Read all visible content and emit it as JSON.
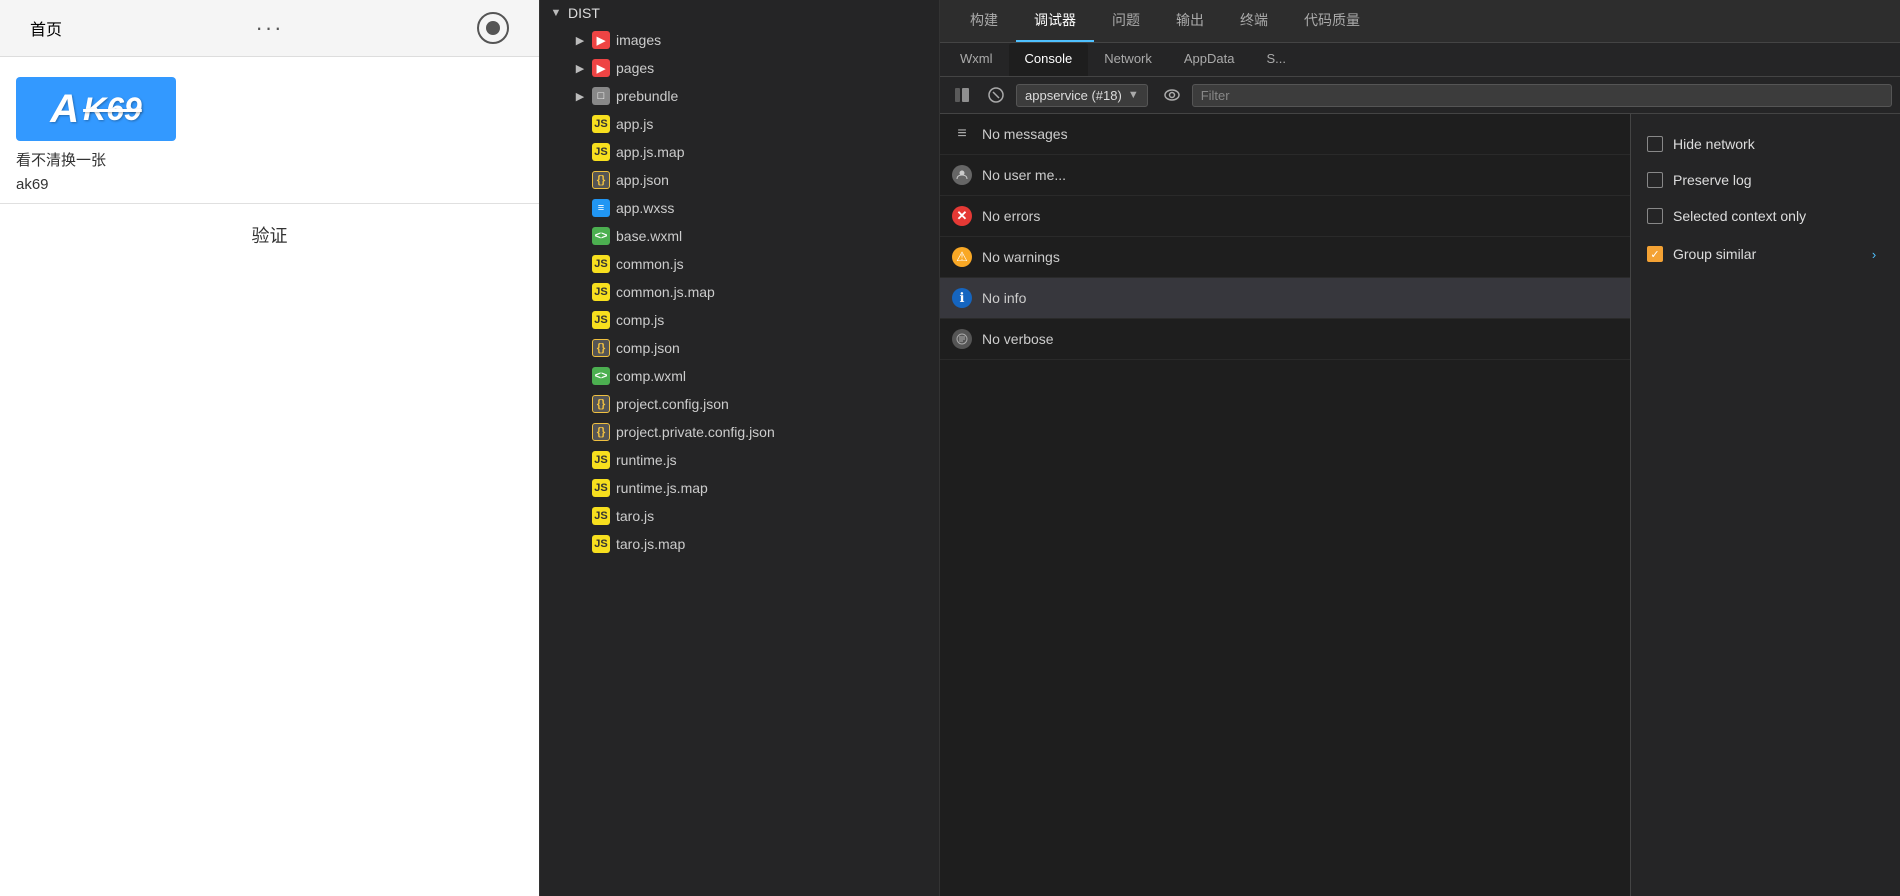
{
  "phone": {
    "title": "首页",
    "dots": "●●●",
    "captcha": {
      "letter": "A",
      "text": "K69",
      "refresh_link": "看不清换一张",
      "input_value": "ak69",
      "verify_btn": "验证"
    }
  },
  "file_tree": {
    "root": "DIST",
    "items": [
      {
        "name": "images",
        "type": "folder-red",
        "indent": 1,
        "arrow": true
      },
      {
        "name": "pages",
        "type": "folder-red",
        "indent": 1,
        "arrow": true
      },
      {
        "name": "prebundle",
        "type": "folder-blue",
        "indent": 1,
        "arrow": true
      },
      {
        "name": "app.js",
        "type": "js",
        "indent": 1
      },
      {
        "name": "app.js.map",
        "type": "js",
        "indent": 1
      },
      {
        "name": "app.json",
        "type": "json",
        "indent": 1
      },
      {
        "name": "app.wxss",
        "type": "wxss",
        "indent": 1
      },
      {
        "name": "base.wxml",
        "type": "wxml",
        "indent": 1
      },
      {
        "name": "common.js",
        "type": "js",
        "indent": 1
      },
      {
        "name": "common.js.map",
        "type": "js",
        "indent": 1
      },
      {
        "name": "comp.js",
        "type": "js",
        "indent": 1
      },
      {
        "name": "comp.json",
        "type": "json",
        "indent": 1
      },
      {
        "name": "comp.wxml",
        "type": "wxml",
        "indent": 1
      },
      {
        "name": "project.config.json",
        "type": "json",
        "indent": 1
      },
      {
        "name": "project.private.config.json",
        "type": "json",
        "indent": 1
      },
      {
        "name": "runtime.js",
        "type": "js",
        "indent": 1
      },
      {
        "name": "runtime.js.map",
        "type": "js",
        "indent": 1
      },
      {
        "name": "taro.js",
        "type": "js",
        "indent": 1
      },
      {
        "name": "taro.js.map",
        "type": "js",
        "indent": 1
      }
    ]
  },
  "devtools": {
    "tabs": [
      {
        "label": "构建",
        "active": false
      },
      {
        "label": "调试器",
        "active": true
      },
      {
        "label": "问题",
        "active": false
      },
      {
        "label": "输出",
        "active": false
      },
      {
        "label": "终端",
        "active": false
      },
      {
        "label": "代码质量",
        "active": false
      }
    ],
    "subtabs": [
      {
        "label": "Wxml",
        "active": false
      },
      {
        "label": "Console",
        "active": true
      },
      {
        "label": "Network",
        "active": false
      },
      {
        "label": "AppData",
        "active": false
      },
      {
        "label": "S...",
        "active": false
      }
    ],
    "toolbar": {
      "context_label": "appservice (#18)",
      "filter_placeholder": "Filter"
    },
    "console_items": [
      {
        "id": "messages",
        "icon": "list",
        "text": "No messages"
      },
      {
        "id": "user",
        "icon": "user",
        "text": "No user me..."
      },
      {
        "id": "errors",
        "icon": "error",
        "text": "No errors"
      },
      {
        "id": "warnings",
        "icon": "warning",
        "text": "No warnings"
      },
      {
        "id": "info",
        "icon": "info",
        "text": "No info",
        "active": true
      },
      {
        "id": "verbose",
        "icon": "verbose",
        "text": "No verbose"
      }
    ],
    "filter_options": [
      {
        "id": "hide_network",
        "label": "Hide network",
        "checked": false
      },
      {
        "id": "preserve_log",
        "label": "Preserve log",
        "checked": false
      },
      {
        "id": "selected_context",
        "label": "Selected context only",
        "checked": false
      },
      {
        "id": "group_similar",
        "label": "Group similar",
        "checked": true
      }
    ]
  }
}
